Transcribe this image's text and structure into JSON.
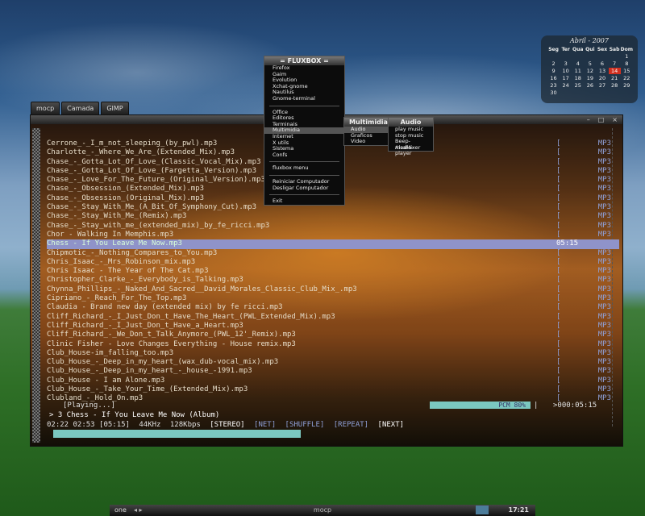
{
  "desktop_tabs": [
    "mocp",
    "Camada",
    "GIMP"
  ],
  "fluxbox_menu": {
    "title": "= FLUXBOX =",
    "items_top": [
      "Firefox",
      "Gaim",
      "Evolution",
      "Xchat-gnome",
      "Nautilus",
      "Gnome-terminal"
    ],
    "items_mid": [
      "Office",
      "Editores",
      "Terminais",
      "Multimidia",
      "Internet",
      "X utils",
      "Sistema",
      "Confs"
    ],
    "items_menu": [
      "fluxbox menu"
    ],
    "items_power": [
      "Reiniciar Computador",
      "Desligar Computador"
    ],
    "items_exit": [
      "Exit"
    ]
  },
  "multimidia_menu": {
    "title": "Multimidia",
    "items": [
      "Audio",
      "Graficos",
      "Video"
    ]
  },
  "audio_menu": {
    "title": "Audio",
    "items": [
      "play music",
      "stop music",
      "Beep-media-player",
      "AlsaMixer"
    ]
  },
  "calendar": {
    "title": "Abril - 2007",
    "days": [
      "Seg",
      "Ter",
      "Qua",
      "Qui",
      "Sex",
      "Sab",
      "Dom"
    ],
    "rows": [
      [
        "",
        "",
        "",
        "",
        "",
        "",
        "1"
      ],
      [
        "2",
        "3",
        "4",
        "5",
        "6",
        "7",
        "8"
      ],
      [
        "9",
        "10",
        "11",
        "12",
        "13",
        "14",
        "15"
      ],
      [
        "16",
        "17",
        "18",
        "19",
        "20",
        "21",
        "22"
      ],
      [
        "23",
        "24",
        "25",
        "26",
        "27",
        "28",
        "29"
      ],
      [
        "30",
        "",
        "",
        "",
        "",
        "",
        ""
      ]
    ],
    "today": "14"
  },
  "playlist": [
    {
      "name": "Cerrone_-_I_m_not_sleeping_(by_pwl).mp3",
      "fmt": "MP3"
    },
    {
      "name": "Charlotte_-_Where_We_Are_(Extended_Mix).mp3",
      "fmt": "MP3"
    },
    {
      "name": "Chase_-_Gotta_Lot_Of_Love_(Classic_Vocal_Mix).mp3",
      "fmt": "MP3"
    },
    {
      "name": "Chase_-_Gotta_Lot_Of_Love_(Fargetta_Version).mp3",
      "fmt": "MP3"
    },
    {
      "name": "Chase_-_Love_For_The_Future_(Original_Version).mp3",
      "fmt": "MP3"
    },
    {
      "name": "Chase_-_Obsession_(Extended_Mix).mp3",
      "fmt": "MP3"
    },
    {
      "name": "Chase_-_Obsession_(Original_Mix).mp3",
      "fmt": "MP3"
    },
    {
      "name": "Chase_-_Stay_With_Me_(A_Bit_Of_Symphony_Cut).mp3",
      "fmt": "MP3"
    },
    {
      "name": "Chase_-_Stay_With_Me_(Remix).mp3",
      "fmt": "MP3"
    },
    {
      "name": "Chase_-_Stay_with_me_(extended_mix)_by_fe_ricci.mp3",
      "fmt": "MP3"
    },
    {
      "name": "Chor - Walking In Memphis.mp3",
      "fmt": "MP3"
    },
    {
      "name": "Chess - If You Leave Me Now.mp3",
      "time": "05:15",
      "selected": true
    },
    {
      "name": "Chipmotic_-_Nothing_Compares_to_You.mp3",
      "fmt": "MP3"
    },
    {
      "name": "Chris_Isaac_-_Mrs_Robinson_mix.mp3",
      "fmt": "MP3"
    },
    {
      "name": "Chris Isaac - The Year of The Cat.mp3",
      "fmt": "MP3"
    },
    {
      "name": "Christopher_Clarke_-_Everybody_is_Talking.mp3",
      "fmt": "MP3"
    },
    {
      "name": "Chynna_Phillips_-_Naked_And_Sacred__David_Morales_Classic_Club_Mix_.mp3",
      "fmt": "MP3"
    },
    {
      "name": "Cipriano_-_Reach_For_The_Top.mp3",
      "fmt": "MP3"
    },
    {
      "name": "Claudia - Brand new day (extended mix) by fe ricci.mp3",
      "fmt": "MP3"
    },
    {
      "name": "Cliff_Richard_-_I_Just_Don_t_Have_The_Heart_(PWL_Extended_Mix).mp3",
      "fmt": "MP3"
    },
    {
      "name": "Cliff_Richard_-_I_Just_Don_t_Have_a_Heart.mp3",
      "fmt": "MP3"
    },
    {
      "name": "Cliff_Richard_-_We_Don_t_Talk_Anymore_(PWL_12'_Remix).mp3",
      "fmt": "MP3"
    },
    {
      "name": "Clinic Fisher - Love Changes Everything - House remix.mp3",
      "fmt": "MP3"
    },
    {
      "name": "Club_House-im_falling_too.mp3",
      "fmt": "MP3"
    },
    {
      "name": "Club_House_-_Deep_in_my_heart_(wax_dub-vocal_mix).mp3",
      "fmt": "MP3"
    },
    {
      "name": "Club_House_-_Deep_in_my_heart_-_house_-1991.mp3",
      "fmt": "MP3"
    },
    {
      "name": "Club_House - I am Alone.mp3",
      "fmt": "MP3"
    },
    {
      "name": "Club_House_-_Take_Your_Time_(Extended_Mix).mp3",
      "fmt": "MP3"
    },
    {
      "name": "Clubland_-_Hold_On.mp3",
      "fmt": "MP3"
    }
  ],
  "status": {
    "state": "[Playing...]",
    "pcm": "PCM  80%",
    "elapsed_box": ">000:05:15",
    "now_playing": "> 3 Chess - If You Leave Me Now (Album)",
    "times": "02:22 02:53 [05:15]",
    "freq": "44KHz",
    "bitrate": "128Kbps",
    "stereo": "[STEREO]",
    "net": "[NET]",
    "shuffle": "[SHUFFLE]",
    "repeat": "[REPEAT]",
    "next": "[NEXT]",
    "progress": 0.45
  },
  "taskbar": {
    "workspace": "one",
    "title": "mocp",
    "clock": "17:21"
  }
}
